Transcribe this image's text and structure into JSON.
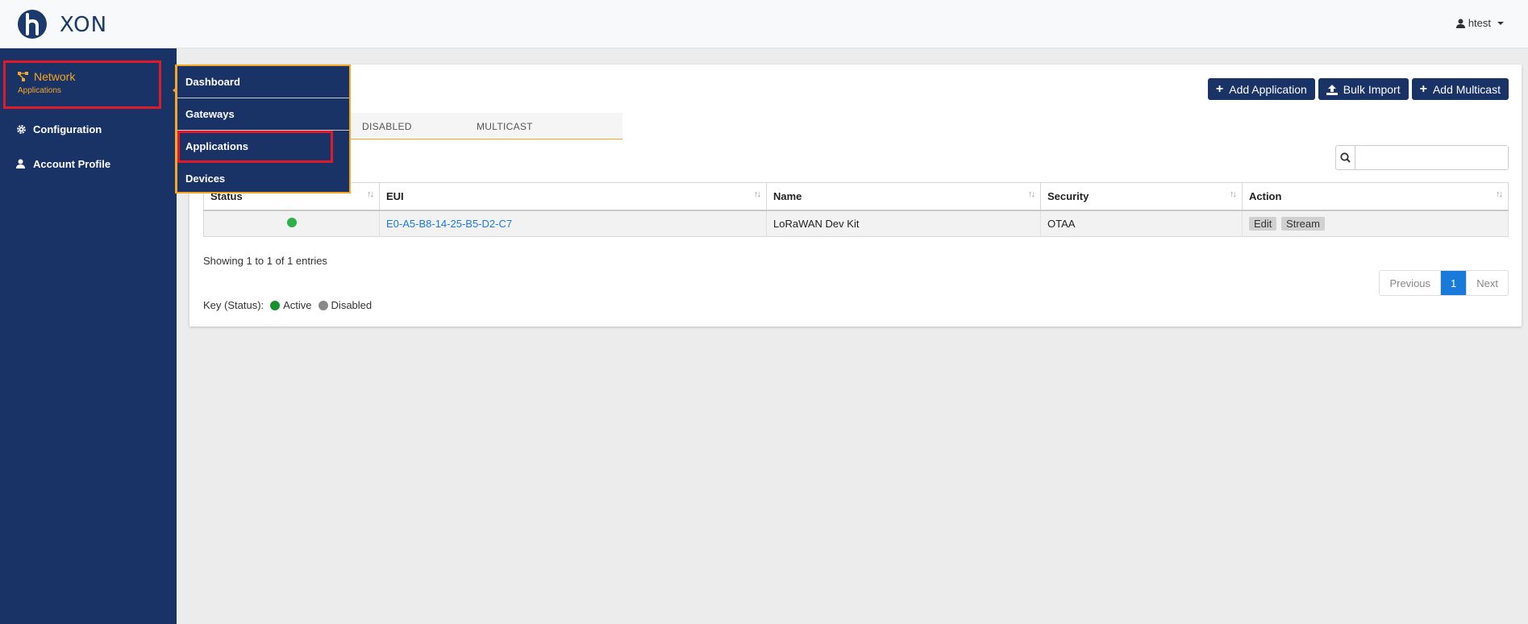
{
  "header": {
    "brand": "XON",
    "user": "htest"
  },
  "sidebar": {
    "network": {
      "label": "Network",
      "sub": "Applications"
    },
    "configuration": "Configuration",
    "account_profile": "Account Profile"
  },
  "flyout": {
    "items": [
      "Dashboard",
      "Gateways",
      "Applications",
      "Devices"
    ]
  },
  "toolbar": {
    "add_application": "Add Application",
    "bulk_import": "Bulk Import",
    "add_multicast": "Add Multicast"
  },
  "tabs": [
    "DISABLED",
    "MULTICAST"
  ],
  "table": {
    "headers": [
      "Status",
      "EUI",
      "Name",
      "Security",
      "Action"
    ],
    "rows": [
      {
        "eui": "E0-A5-B8-14-25-B5-D2-C7",
        "name": "LoRaWAN Dev Kit",
        "security": "OTAA",
        "actions": [
          "Edit",
          "Stream"
        ]
      }
    ]
  },
  "showing": "Showing 1 to 1 of 1 entries",
  "pagination": {
    "previous": "Previous",
    "current": "1",
    "next": "Next"
  },
  "key": {
    "label": "Key (Status):",
    "active": "Active",
    "disabled": "Disabled"
  },
  "colors": {
    "navy": "#1a3366",
    "accent": "#f5a623",
    "highlight": "#e11a2a",
    "active": "#2bb04a",
    "disabled": "#888888",
    "link": "#1a7ad9"
  }
}
